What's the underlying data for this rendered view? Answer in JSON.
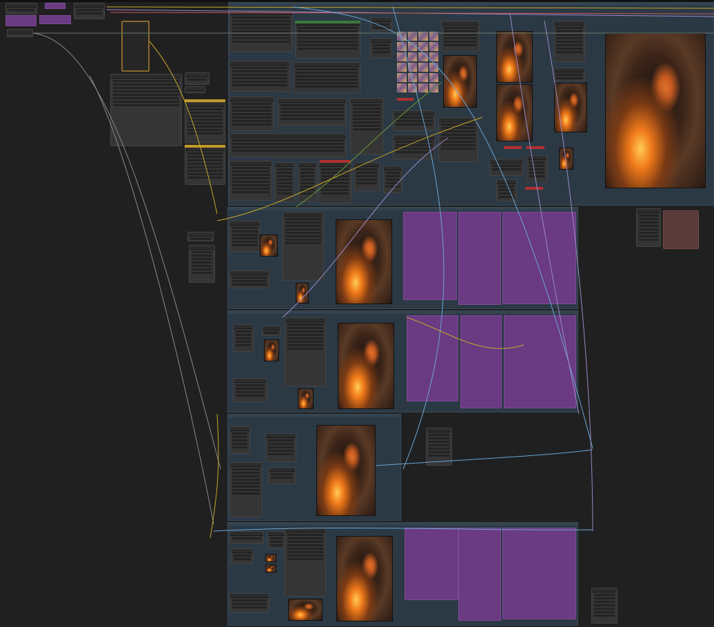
{
  "canvas": {
    "background": "#202020"
  },
  "colors": {
    "group": "#2b3945",
    "node": "#353535",
    "node_header": "#2c2c2c",
    "muted_node": "#6a3a82",
    "bypassed_node_border": "#c49a2c",
    "error_bar": "#b03030",
    "success_bar": "#3a8a3a",
    "wire_yellow": "#c8a828",
    "wire_purple": "#9a8ac8",
    "wire_blue": "#6aa8d8",
    "wire_green": "#6a9a3a",
    "wire_red": "#c85a5a",
    "wire_grey": "#8a8a8a"
  },
  "icons": [
    "image-preview-icon",
    "node-collapse-icon"
  ]
}
